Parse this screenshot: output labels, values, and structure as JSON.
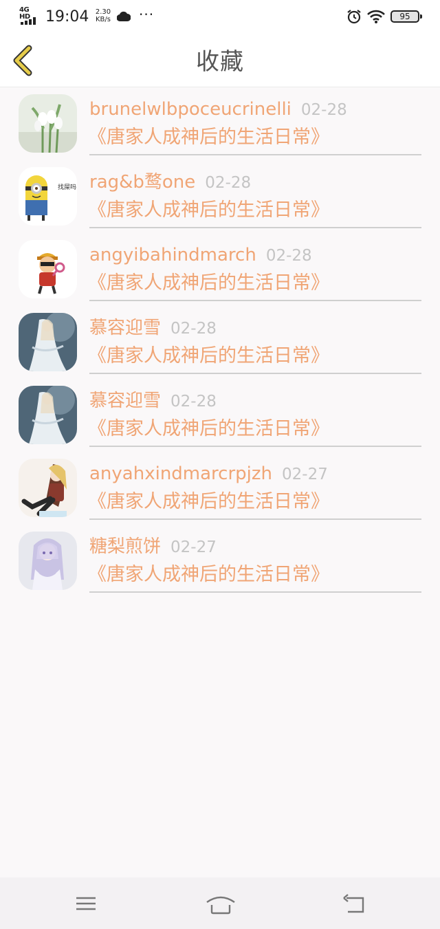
{
  "status_bar": {
    "network": "4G HD",
    "time": "19:04",
    "speed_value": "2.30",
    "speed_unit": "KB/s",
    "battery": "95",
    "icons": [
      "signal-icon",
      "cloud-icon",
      "more-dots-icon",
      "alarm-icon",
      "wifi-icon",
      "battery-icon"
    ]
  },
  "header": {
    "title": "收藏",
    "back_icon": "chevron-left-icon",
    "accent_color": "#c9a82a"
  },
  "favorites": [
    {
      "name": "brunelwlbpoceucrinelli",
      "date": "02-28",
      "book": "《唐家人成神后的生活日常》",
      "avatar": "snowdrop-flower-photo"
    },
    {
      "name": "rag&b鹜one",
      "date": "02-28",
      "book": "《唐家人成神后的生活日常》",
      "avatar": "minion-cartoon",
      "avatar_text": "找屎吗"
    },
    {
      "name": "angyibahindmarch",
      "date": "02-28",
      "book": "《唐家人成神后的生活日常》",
      "avatar": "cartoon-character-magnifier"
    },
    {
      "name": "慕容迎雪",
      "date": "02-28",
      "book": "《唐家人成神后的生活日常》",
      "avatar": "anime-girl-white-dress"
    },
    {
      "name": "慕容迎雪",
      "date": "02-28",
      "book": "《唐家人成神后的生活日常》",
      "avatar": "anime-girl-white-dress"
    },
    {
      "name": "anyahxindmarcrpjzh",
      "date": "02-27",
      "book": "《唐家人成神后的生活日常》",
      "avatar": "anime-girl-boots"
    },
    {
      "name": "糖梨煎饼",
      "date": "02-27",
      "book": "《唐家人成神后的生活日常》",
      "avatar": "anime-girl-lavender-hair"
    }
  ],
  "colors": {
    "name_text": "#f0a575",
    "date_text": "#c4c4c4",
    "divider": "#cfcfcf",
    "background": "#faf8f9"
  },
  "nav_bar": {
    "icons": [
      "menu-icon",
      "home-icon",
      "back-icon"
    ]
  }
}
